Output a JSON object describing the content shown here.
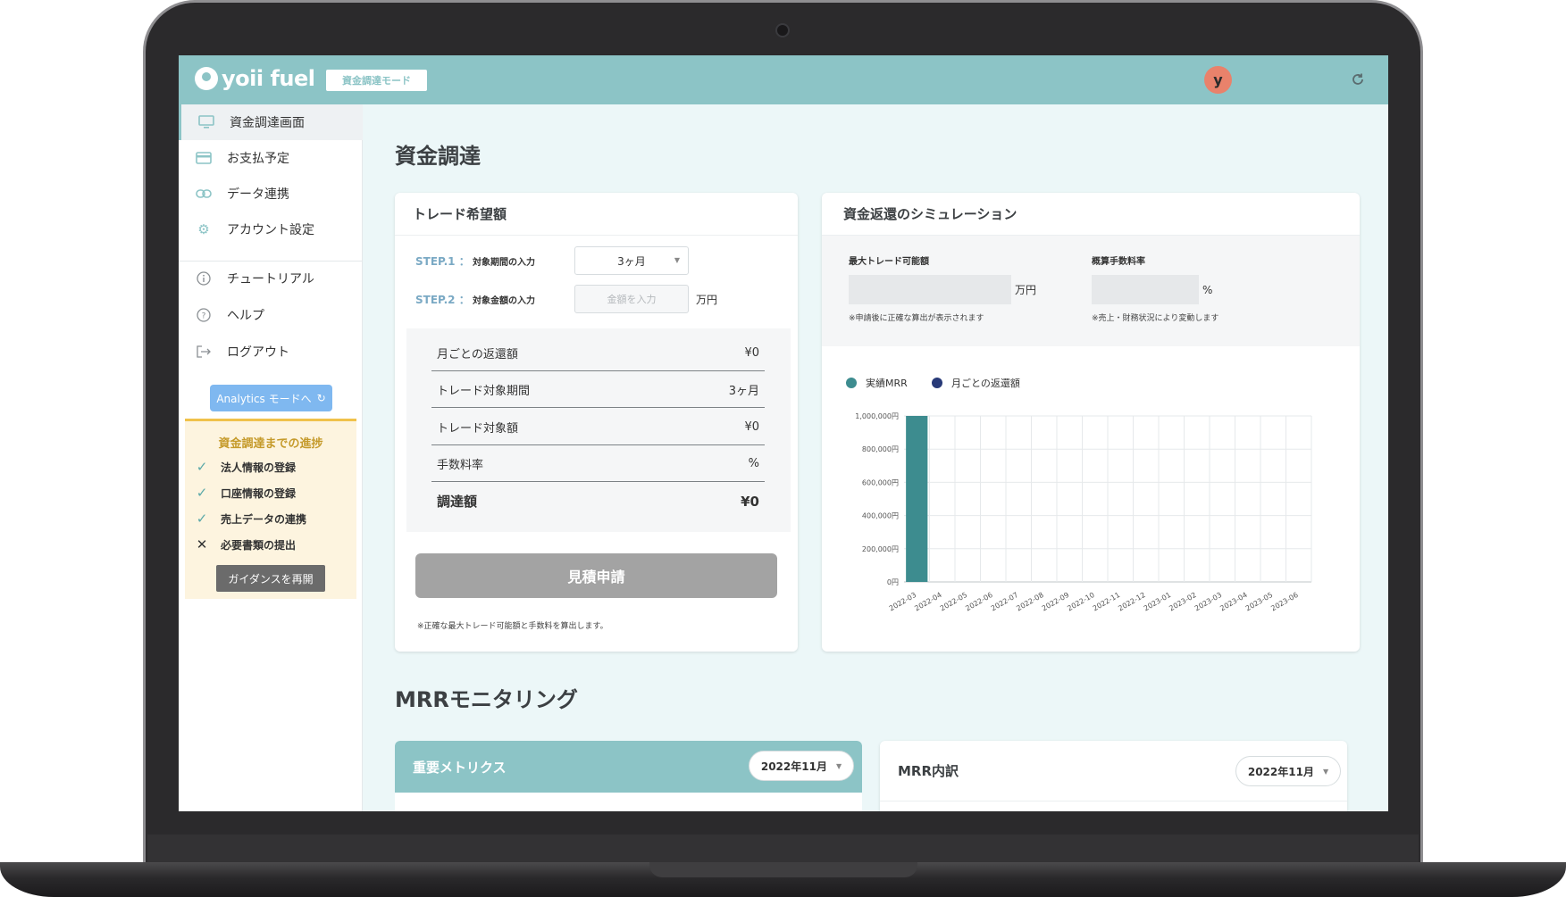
{
  "app": {
    "logo_text": "yoii fuel",
    "mode_badge": "資金調達モード",
    "avatar_initial": "y"
  },
  "sidebar": {
    "items": [
      {
        "label": "資金調達画面",
        "icon": "monitor-icon"
      },
      {
        "label": "お支払予定",
        "icon": "card-icon"
      },
      {
        "label": "データ連携",
        "icon": "link-icon"
      },
      {
        "label": "アカウント設定",
        "icon": "gear-icon"
      },
      {
        "label": "チュートリアル",
        "icon": "info-icon"
      },
      {
        "label": "ヘルプ",
        "icon": "help-icon"
      },
      {
        "label": "ログアウト",
        "icon": "logout-icon"
      }
    ],
    "analytics_button": "Analytics モードへ",
    "progress": {
      "title": "資金調達までの進捗",
      "items": [
        {
          "label": "法人情報の登録",
          "done": true
        },
        {
          "label": "口座情報の登録",
          "done": true
        },
        {
          "label": "売上データの連携",
          "done": true
        },
        {
          "label": "必要書類の提出",
          "done": false
        }
      ],
      "guidance_button": "ガイダンスを再開"
    }
  },
  "page_title": "資金調達",
  "trade_card": {
    "title": "トレード希望額",
    "step1": {
      "label": "STEP.1 ：",
      "text": "対象期間の入力",
      "value": "3ヶ月"
    },
    "step2": {
      "label": "STEP.2 ：",
      "text": "対象金額の入力",
      "placeholder": "金額を入力",
      "unit": "万円"
    },
    "summary": [
      {
        "label": "月ごとの返還額",
        "value": "¥0"
      },
      {
        "label": "トレード対象期間",
        "value": "3ヶ月"
      },
      {
        "label": "トレード対象額",
        "value": "¥0"
      },
      {
        "label": "手数料率",
        "value": "%"
      },
      {
        "label": "調達額",
        "value": "¥0"
      }
    ],
    "estimate_button": "見積申請",
    "note": "※正確な最大トレード可能額と手数料を算出します。"
  },
  "sim_card": {
    "title": "資金返還のシミュレーション",
    "max_trade": {
      "label": "最大トレード可能額",
      "unit": "万円",
      "note": "※申請後に正確な算出が表示されます"
    },
    "fee_rate": {
      "label": "概算手数料率",
      "unit": "%",
      "note": "※売上・財務状況により変動します"
    },
    "legend": [
      {
        "name": "実績MRR",
        "color": "#3d8c8f"
      },
      {
        "name": "月ごとの返還額",
        "color": "#283a78"
      }
    ]
  },
  "chart_data": {
    "type": "bar",
    "categories": [
      "2022-03",
      "2022-04",
      "2022-05",
      "2022-06",
      "2022-07",
      "2022-08",
      "2022-09",
      "2022-10",
      "2022-11",
      "2022-12",
      "2023-01",
      "2023-02",
      "2023-03",
      "2023-04",
      "2023-05",
      "2023-06"
    ],
    "series": [
      {
        "name": "実績MRR",
        "values": [
          1000000,
          0,
          0,
          0,
          0,
          0,
          0,
          0,
          0,
          0,
          0,
          0,
          0,
          0,
          0,
          0
        ],
        "color": "#3d8c8f"
      },
      {
        "name": "月ごとの返還額",
        "values": [
          0,
          0,
          0,
          0,
          0,
          0,
          0,
          0,
          0,
          0,
          0,
          0,
          0,
          0,
          0,
          0
        ],
        "color": "#283a78"
      }
    ],
    "yticks": [
      "0円",
      "200,000円",
      "400,000円",
      "600,000円",
      "800,000円",
      "1,000,000円"
    ],
    "ylim": [
      0,
      1000000
    ],
    "grid": true
  },
  "mrr_section": {
    "title": "MRRモニタリング",
    "metrics_title": "重要メトリクス",
    "metrics_month": "2022年11月",
    "breakdown_title": "MRR内訳",
    "breakdown_month": "2022年11月"
  }
}
